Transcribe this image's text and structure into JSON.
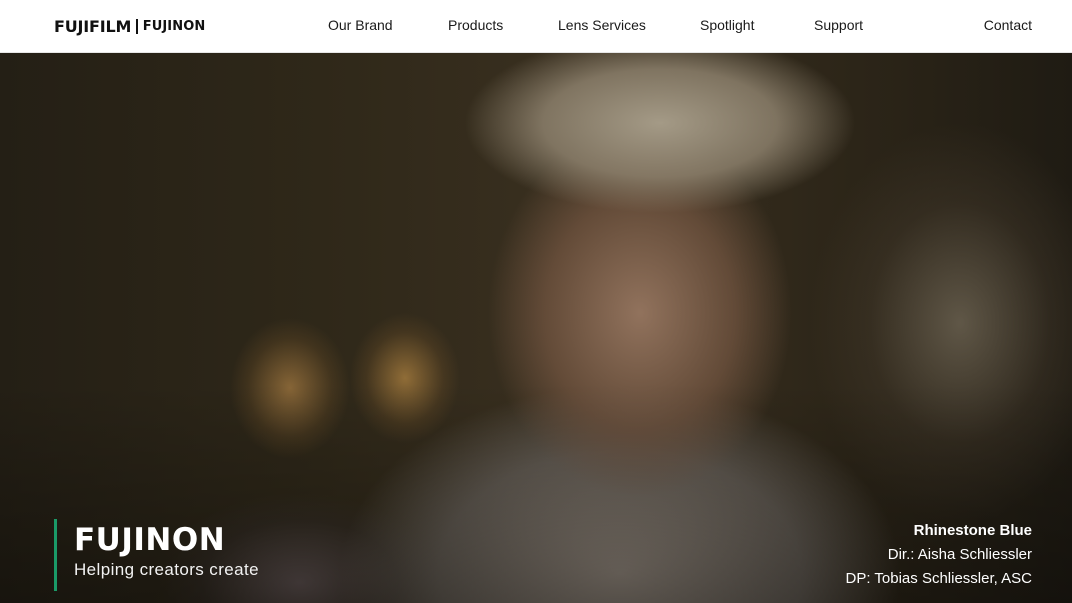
{
  "header": {
    "logo_primary": "FUJIFILM",
    "logo_secondary": "FUJINON",
    "nav": [
      {
        "label": "Our Brand"
      },
      {
        "label": "Products"
      },
      {
        "label": "Lens Services"
      },
      {
        "label": "Spotlight"
      },
      {
        "label": "Support"
      }
    ],
    "contact_label": "Contact"
  },
  "hero": {
    "brand_wordmark": "FUJINON",
    "tagline": "Helping creators create",
    "accent_color": "#1a9a68",
    "credit": {
      "title": "Rhinestone Blue",
      "director": "Dir.: Aisha Schliessler",
      "dp": "DP: Tobias Schliessler, ASC"
    }
  }
}
